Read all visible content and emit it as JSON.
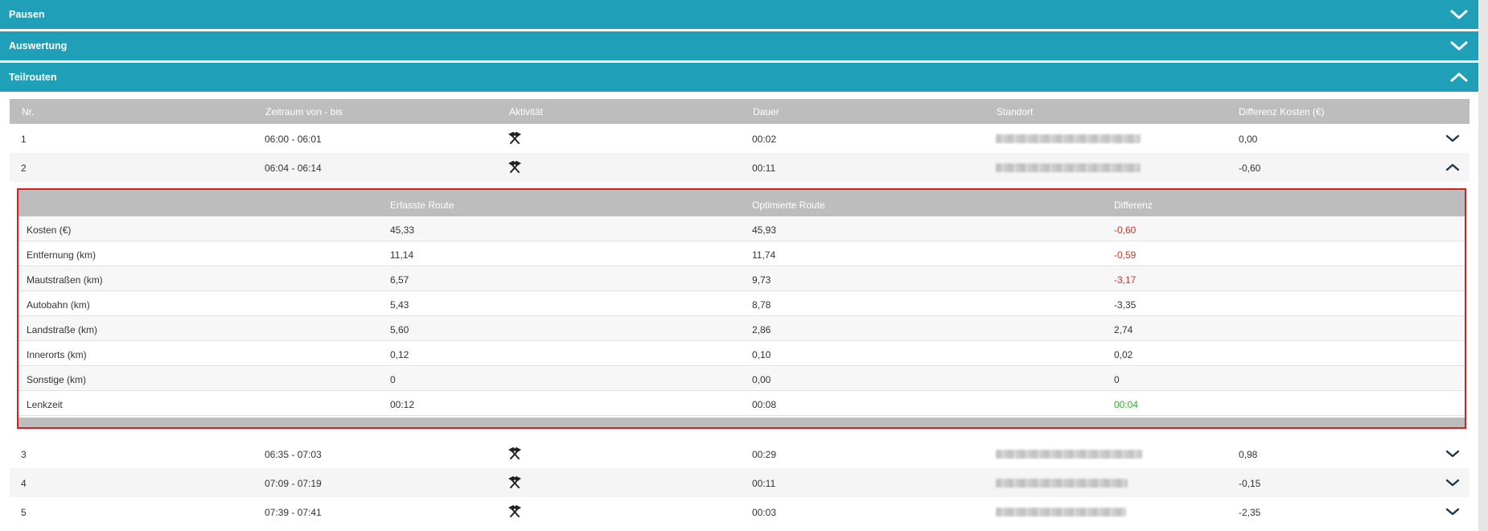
{
  "sections": [
    {
      "title": "Pausen",
      "expanded": false
    },
    {
      "title": "Auswertung",
      "expanded": false
    },
    {
      "title": "Teilrouten",
      "expanded": true
    }
  ],
  "table": {
    "headers": [
      "Nr.",
      "Zeitraum von - bis",
      "Aktivität",
      "Dauer",
      "Standort",
      "Differenz Kosten (€)"
    ],
    "rows_top": [
      {
        "nr": "1",
        "zeitraum": "06:00 - 06:01",
        "aktivitaet_icon": "hammer-pick-icon",
        "dauer": "00:02",
        "differenz": "0,00"
      },
      {
        "nr": "2",
        "zeitraum": "06:04 - 06:14",
        "aktivitaet_icon": "hammer-pick-icon",
        "dauer": "00:11",
        "differenz": "-0,60"
      }
    ],
    "rows_bottom": [
      {
        "nr": "3",
        "zeitraum": "06:35 - 07:03",
        "aktivitaet_icon": "hammer-pick-icon",
        "dauer": "00:29",
        "differenz": "0,98"
      },
      {
        "nr": "4",
        "zeitraum": "07:09 - 07:19",
        "aktivitaet_icon": "hammer-pick-icon",
        "dauer": "00:11",
        "differenz": "-0,15"
      },
      {
        "nr": "5",
        "zeitraum": "07:39 - 07:41",
        "aktivitaet_icon": "hammer-pick-icon",
        "dauer": "00:03",
        "differenz": "-2,35"
      }
    ]
  },
  "detail": {
    "headers": [
      "",
      "Erfasste Route",
      "Optimierte Route",
      "Differenz"
    ],
    "rows": [
      {
        "label": "Kosten (€)",
        "erfasst": "45,33",
        "optimiert": "45,93",
        "differenz": "-0,60",
        "status": "neg"
      },
      {
        "label": "Entfernung (km)",
        "erfasst": "11,14",
        "optimiert": "11,74",
        "differenz": "-0,59",
        "status": "neg"
      },
      {
        "label": "Mautstraßen (km)",
        "erfasst": "6,57",
        "optimiert": "9,73",
        "differenz": "-3,17",
        "status": "neg"
      },
      {
        "label": "Autobahn (km)",
        "erfasst": "5,43",
        "optimiert": "8,78",
        "differenz": "-3,35",
        "status": ""
      },
      {
        "label": "Landstraße (km)",
        "erfasst": "5,60",
        "optimiert": "2,86",
        "differenz": "2,74",
        "status": ""
      },
      {
        "label": "Innerorts (km)",
        "erfasst": "0,12",
        "optimiert": "0,10",
        "differenz": "0,02",
        "status": ""
      },
      {
        "label": "Sonstige (km)",
        "erfasst": "0",
        "optimiert": "0,00",
        "differenz": "0",
        "status": ""
      },
      {
        "label": "Lenkzeit",
        "erfasst": "00:12",
        "optimiert": "00:08",
        "differenz": "00:04",
        "status": "pos"
      }
    ]
  },
  "colors": {
    "header_teal": "#20a0b8",
    "table_head": "#bdbdbd",
    "negative": "#c0392b",
    "positive": "#3aa83a",
    "highlight_border": "#d42020"
  }
}
